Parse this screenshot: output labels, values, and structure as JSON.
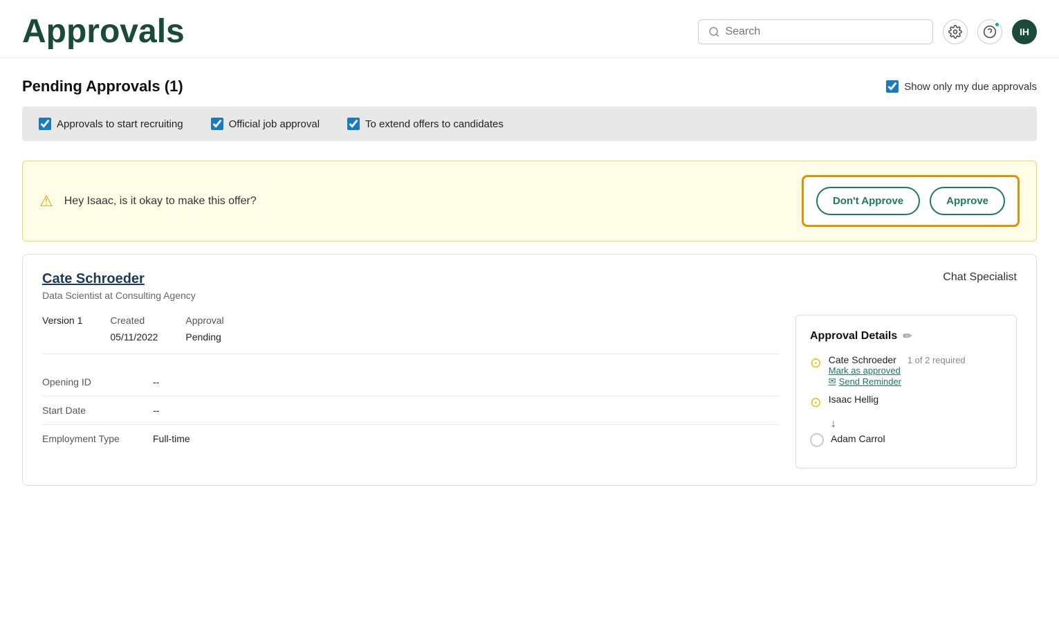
{
  "header": {
    "title": "Approvals",
    "search_placeholder": "Search",
    "settings_icon": "gear-icon",
    "help_icon": "question-mark-icon",
    "avatar_initials": "IH"
  },
  "pending_section": {
    "title": "Pending Approvals (1)",
    "show_only_label": "Show only my due approvals",
    "show_only_checked": true
  },
  "filters": [
    {
      "label": "Approvals to start recruiting",
      "checked": true
    },
    {
      "label": "Official job approval",
      "checked": true
    },
    {
      "label": "To extend offers to candidates",
      "checked": true
    }
  ],
  "alert": {
    "text": "Hey Isaac, is it okay to make this offer?",
    "btn_dont_approve": "Don't Approve",
    "btn_approve": "Approve"
  },
  "card": {
    "candidate_name": "Cate Schroeder",
    "candidate_sub": "Data Scientist at Consulting Agency",
    "job_title": "Chat Specialist",
    "version": "Version 1",
    "created_label": "Created",
    "created_value": "05/11/2022",
    "approval_label": "Approval",
    "approval_value": "Pending",
    "opening_id_label": "Opening ID",
    "opening_id_value": "--",
    "start_date_label": "Start Date",
    "start_date_value": "--",
    "employment_type_label": "Employment Type",
    "employment_type_value": "Full-time",
    "approval_details": {
      "title": "Approval Details",
      "edit_icon": "pencil-icon",
      "approvers": [
        {
          "name": "Cate Schroeder",
          "required": "1 of 2 required",
          "mark_approved_label": "Mark as approved",
          "send_reminder_label": "Send Reminder",
          "status": "pending-circle"
        },
        {
          "name": "Isaac Hellig",
          "required": "",
          "status": "pending-circle"
        },
        {
          "name": "Adam Carrol",
          "required": "",
          "status": "empty-circle"
        }
      ]
    }
  }
}
